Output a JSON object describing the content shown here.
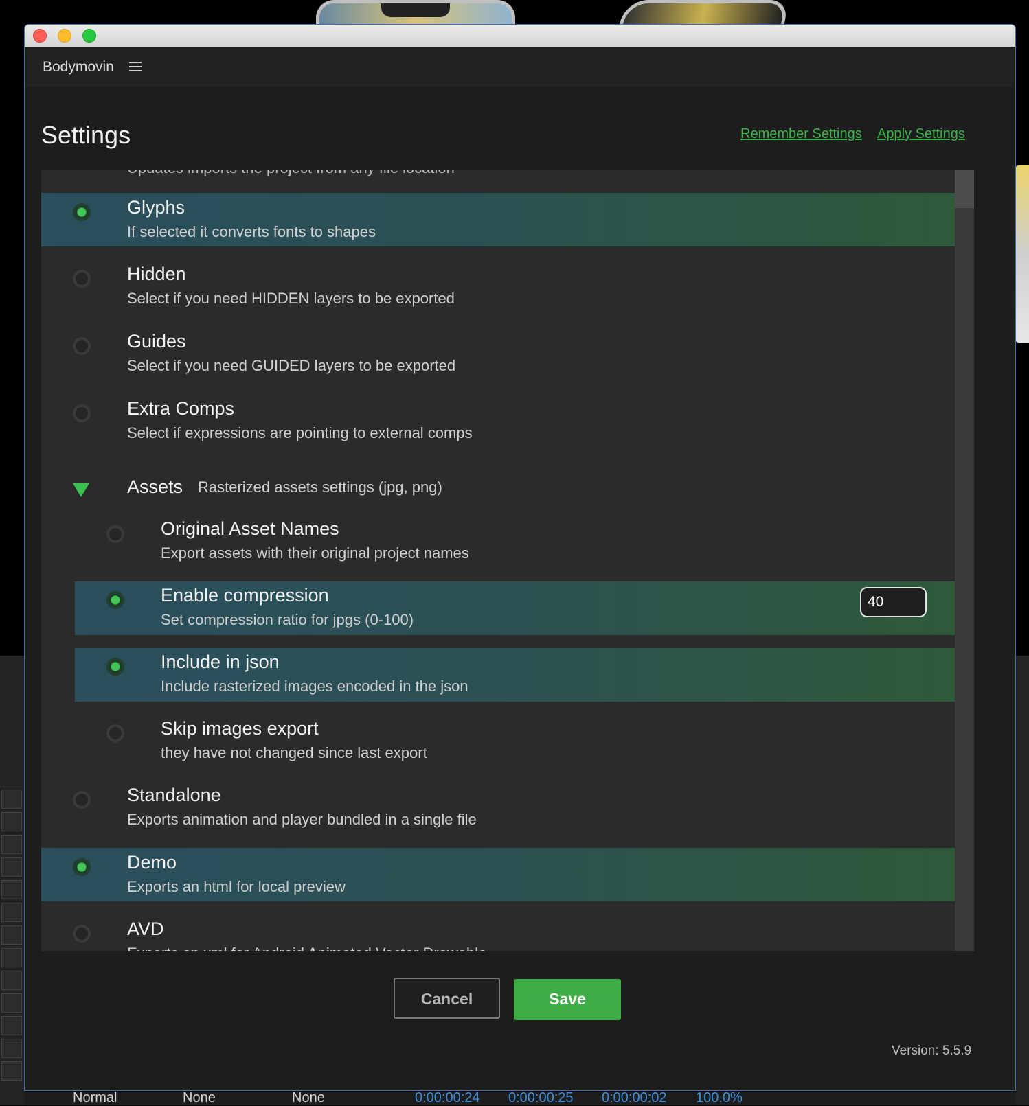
{
  "window": {
    "app_name": "Bodymovin",
    "menu_icon": "hamburger-menu-icon"
  },
  "header": {
    "title": "Settings",
    "remember_label": "Remember Settings",
    "apply_label": "Apply Settings"
  },
  "settings": {
    "glyphs": {
      "title": "Glyphs",
      "desc": "If selected it converts fonts to shapes",
      "selected": true
    },
    "hidden": {
      "title": "Hidden",
      "desc": "Select if you need HIDDEN layers to be exported",
      "selected": false
    },
    "guides": {
      "title": "Guides",
      "desc": "Select if you need GUIDED layers to be exported",
      "selected": false
    },
    "extra_comps": {
      "title": "Extra Comps",
      "desc": "Select if expressions are pointing to external comps",
      "selected": false
    },
    "assets": {
      "title": "Assets",
      "desc": "Rasterized assets settings (jpg, png)",
      "expanded": true,
      "original_names": {
        "title": "Original Asset Names",
        "desc": "Export assets with their original project names",
        "selected": false
      },
      "compression": {
        "title": "Enable compression",
        "desc": "Set compression ratio for jpgs (0-100)",
        "selected": true,
        "value": "40"
      },
      "include_json": {
        "title": "Include in json",
        "desc": "Include rasterized images encoded in the json",
        "selected": true
      },
      "skip_images": {
        "title": "Skip images export",
        "desc": "they have not changed since last export",
        "selected": false
      }
    },
    "standalone": {
      "title": "Standalone",
      "desc": "Exports animation and player bundled in a single file",
      "selected": false
    },
    "demo": {
      "title": "Demo",
      "desc": "Exports an html for local preview",
      "selected": true
    },
    "avd": {
      "title": "AVD",
      "desc": "Exports an xml for Android Animated Vector Drawable",
      "selected": false
    }
  },
  "footer": {
    "cancel_label": "Cancel",
    "save_label": "Save",
    "version": "Version: 5.5.9"
  },
  "background_bar": {
    "blend_mode": "Normal",
    "track_matte": "None",
    "parent": "None",
    "time_in": "0:00:00:24",
    "time_out": "0:00:00:25",
    "duration": "0:00:00:02",
    "stretch": "100.0%"
  },
  "colors": {
    "accent_green": "#3ead48",
    "link_green": "#3bb54a",
    "timecode_blue": "#3d8fe0"
  }
}
